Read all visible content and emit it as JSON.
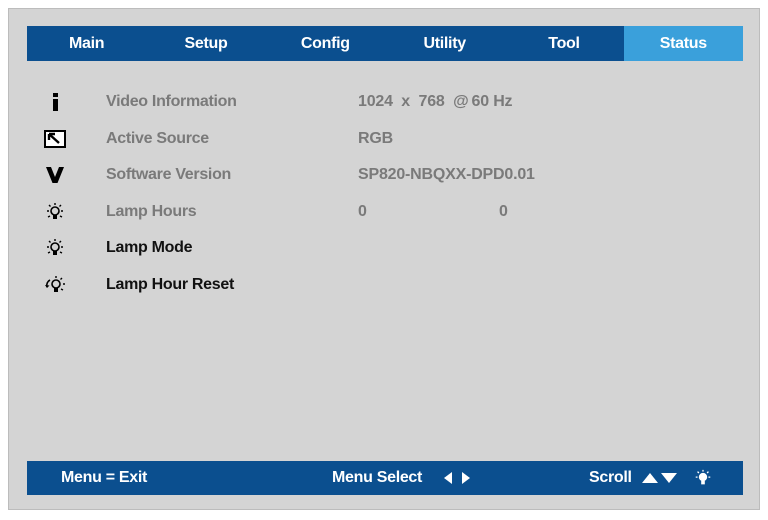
{
  "tabs": [
    {
      "label": "Main",
      "active": false
    },
    {
      "label": "Setup",
      "active": false
    },
    {
      "label": "Config",
      "active": false
    },
    {
      "label": "Utility",
      "active": false
    },
    {
      "label": "Tool",
      "active": false
    },
    {
      "label": "Status",
      "active": true
    }
  ],
  "rows": {
    "video_info": {
      "icon": "info-icon",
      "label": "Video Information",
      "res_w": "1024",
      "x": "x",
      "res_h": "768",
      "at": "@",
      "refresh": "60",
      "unit": "Hz"
    },
    "active_source": {
      "icon": "source-icon",
      "label": "Active Source",
      "value": "RGB"
    },
    "software_version": {
      "icon": "version-icon",
      "label": "Software Version",
      "value": "SP820-NBQXX-DPD0.01"
    },
    "lamp_hours": {
      "icon": "lamp-icon",
      "label": "Lamp Hours",
      "value1": "0",
      "value2": "0"
    },
    "lamp_mode": {
      "icon": "lamp-icon",
      "label": "Lamp Mode"
    },
    "lamp_hour_reset": {
      "icon": "lamp-reset-icon",
      "label": "Lamp Hour Reset"
    }
  },
  "footer": {
    "menu_exit": "Menu = Exit",
    "menu_select": "Menu Select",
    "scroll": "Scroll"
  },
  "colors": {
    "tab_bar": "#0b4f8f",
    "tab_active": "#3aa0db",
    "panel_bg": "#d4d4d4",
    "dim_text": "#7a7a7a"
  }
}
